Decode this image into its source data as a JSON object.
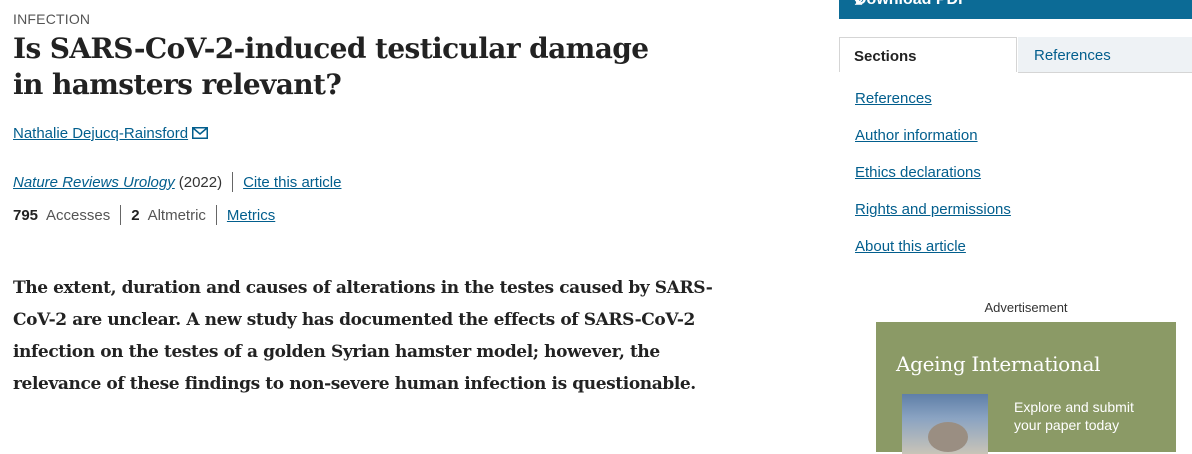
{
  "article": {
    "category": "INFECTION",
    "title": "Is SARS-CoV-2-induced testicular damage in hamsters relevant?",
    "author": "Nathalie Dejucq-Rainsford",
    "journal": "Nature Reviews Urology",
    "year": "(2022)",
    "cite_label": "Cite this article",
    "accesses_count": "795",
    "accesses_label": "Accesses",
    "altmetric_count": "2",
    "altmetric_label": "Altmetric",
    "metrics_label": "Metrics",
    "abstract": "The extent, duration and causes of alterations in the testes caused by SARS-CoV-2 are unclear. A new study has documented the effects of SARS-CoV-2 infection on the testes of a golden Syrian hamster model; however, the relevance of these findings to non-severe human infection is questionable."
  },
  "sidebar": {
    "download_label": "Download PDF",
    "tabs": [
      {
        "label": "Sections"
      },
      {
        "label": "References"
      }
    ],
    "sections": [
      {
        "label": "References"
      },
      {
        "label": "Author information"
      },
      {
        "label": "Ethics declarations"
      },
      {
        "label": "Rights and permissions"
      },
      {
        "label": "About this article"
      }
    ],
    "ad_label": "Advertisement",
    "ad": {
      "title": "Ageing International",
      "text": "Explore and submit your paper today"
    }
  },
  "colors": {
    "link": "#025e8d",
    "pdf_bar": "#0c6b96",
    "ad_background": "#8b9a66"
  },
  "icons": [
    "mail-icon",
    "download-icon"
  ]
}
